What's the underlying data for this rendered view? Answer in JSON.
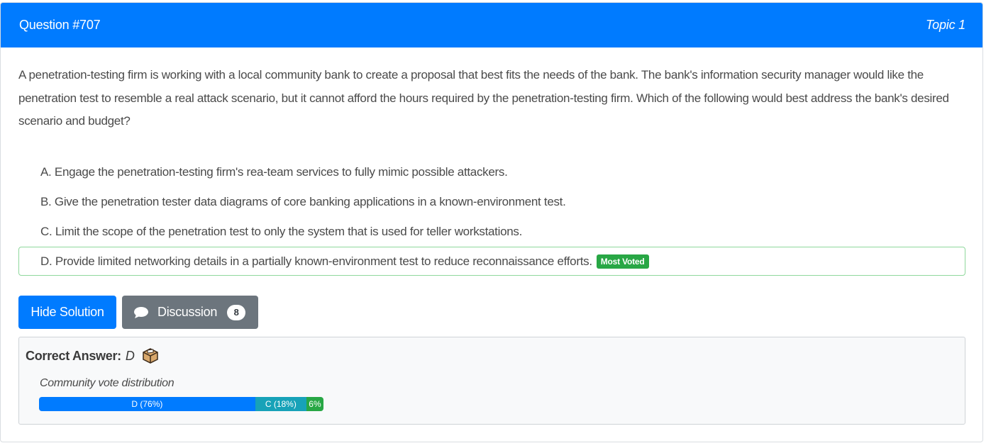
{
  "header": {
    "question_label": "Question #707",
    "topic_label": "Topic 1"
  },
  "question": {
    "text": "A penetration-testing firm is working with a local community bank to create a proposal that best fits the needs of the bank. The bank's information security manager would like the penetration test to resemble a real attack scenario, but it cannot afford the hours required by the penetration-testing firm. Which of the following would best address the bank's desired scenario and budget?"
  },
  "choices": [
    {
      "letter": "A.",
      "text": "Engage the penetration-testing firm's rea-team services to fully mimic possible attackers."
    },
    {
      "letter": "B.",
      "text": "Give the penetration tester data diagrams of core banking applications in a known-environment test."
    },
    {
      "letter": "C.",
      "text": "Limit the scope of the penetration test to only the system that is used for teller workstations."
    },
    {
      "letter": "D.",
      "text": "Provide limited networking details in a partially known-environment test to reduce reconnaissance efforts.",
      "badge": "Most Voted"
    }
  ],
  "buttons": {
    "hide_solution": "Hide Solution",
    "discussion": "Discussion",
    "discussion_count": "8"
  },
  "answer": {
    "label": "Correct Answer:",
    "value": "D",
    "vote_label": "Community vote distribution",
    "votes": [
      {
        "label": "D (76%)",
        "percent": 76,
        "color": "#007bff"
      },
      {
        "label": "C (18%)",
        "percent": 18,
        "color": "#17a2b8"
      },
      {
        "label": "6%",
        "percent": 6,
        "color": "#28a745"
      }
    ]
  },
  "icons": {
    "discussion": "chat-bubble-icon",
    "answer": "ballot-box-icon"
  },
  "colors": {
    "primary": "#007bff",
    "secondary": "#6c757d",
    "success": "#28a745",
    "info": "#17a2b8"
  }
}
